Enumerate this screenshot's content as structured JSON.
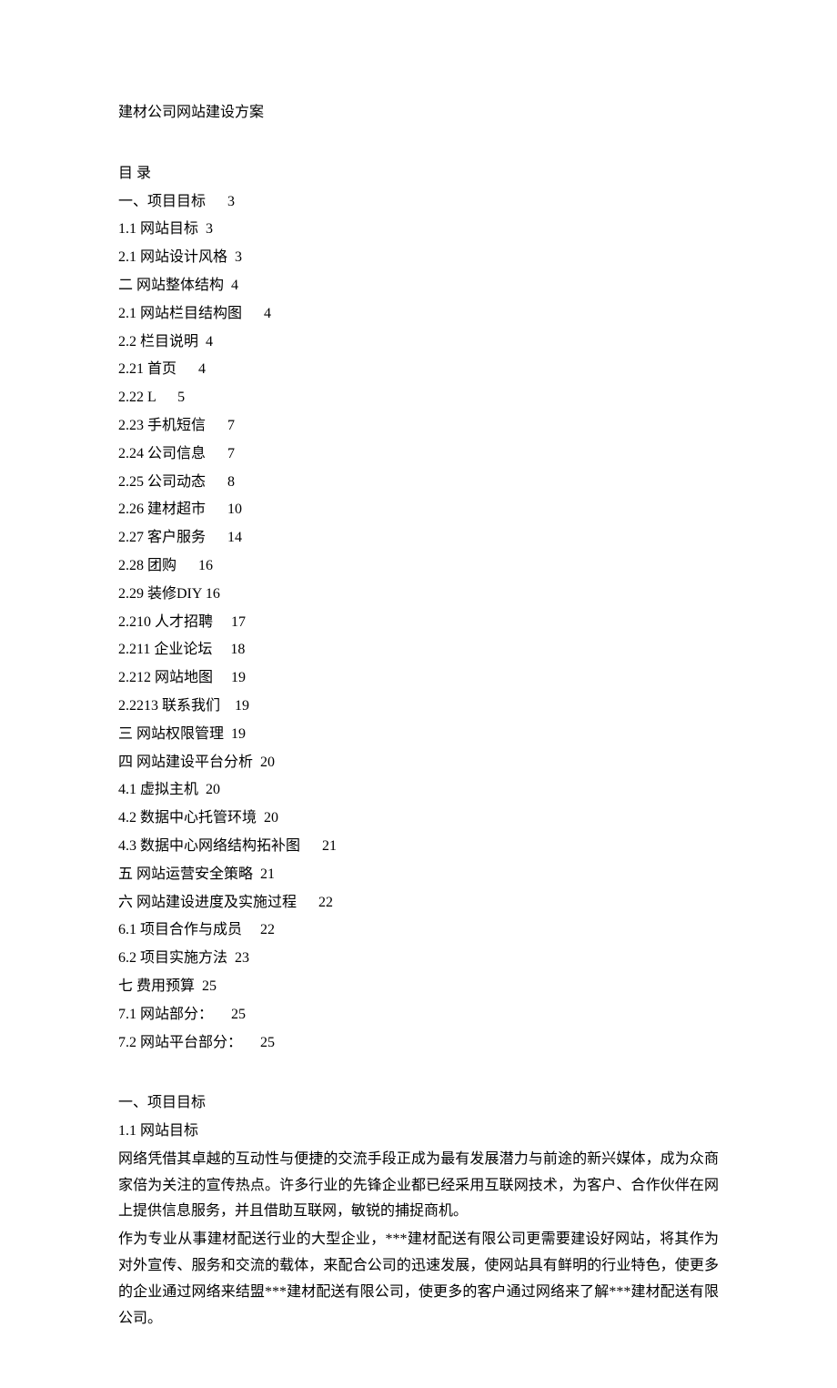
{
  "title": "建材公司网站建设方案",
  "toc_header": "目 录",
  "toc": [
    {
      "label": "一、项目目标",
      "page": "3"
    },
    {
      "label": "1.1 网站目标",
      "page": "3",
      "gap": "  "
    },
    {
      "label": "2.1 网站设计风格",
      "page": "3",
      "gap": "  "
    },
    {
      "label": "二 网站整体结构",
      "page": "4",
      "gap": "  "
    },
    {
      "label": "2.1 网站栏目结构图",
      "page": "4"
    },
    {
      "label": "2.2 栏目说明",
      "page": "4",
      "gap": "  "
    },
    {
      "label": "2.21 首页",
      "page": "4",
      "gap": "      "
    },
    {
      "label": "2.22 L",
      "page": "5"
    },
    {
      "label": "2.23 手机短信",
      "page": "7",
      "gap": "      "
    },
    {
      "label": "2.24 公司信息",
      "page": "7",
      "gap": "      "
    },
    {
      "label": "2.25 公司动态",
      "page": "8",
      "gap": "      "
    },
    {
      "label": "2.26 建材超市",
      "page": "10",
      "gap": "      "
    },
    {
      "label": "2.27 客户服务",
      "page": "14",
      "gap": "      "
    },
    {
      "label": "2.28 团购",
      "page": "16",
      "gap": "      "
    },
    {
      "label": "2.29 装修DIY",
      "page": "16",
      "gap": " "
    },
    {
      "label": "2.210 人才招聘",
      "page": "17",
      "gap": "     "
    },
    {
      "label": "2.211 企业论坛",
      "page": "18",
      "gap": "     "
    },
    {
      "label": "2.212 网站地图",
      "page": "19",
      "gap": "     "
    },
    {
      "label": "2.2213 联系我们",
      "page": "19",
      "gap": "    "
    },
    {
      "label": "三 网站权限管理",
      "page": "19",
      "gap": "  "
    },
    {
      "label": "四 网站建设平台分析",
      "page": "20",
      "gap": "  "
    },
    {
      "label": "4.1 虚拟主机",
      "page": "20",
      "gap": "  "
    },
    {
      "label": "4.2 数据中心托管环境",
      "page": "20",
      "gap": "  "
    },
    {
      "label": "4.3 数据中心网络结构拓补图",
      "page": "21",
      "gap": "      "
    },
    {
      "label": "五 网站运营安全策略",
      "page": "21",
      "gap": "  "
    },
    {
      "label": "六 网站建设进度及实施过程",
      "page": "22",
      "gap": "      "
    },
    {
      "label": "6.1 项目合作与成员",
      "page": "22",
      "gap": "     "
    },
    {
      "label": "6.2 项目实施方法",
      "page": "23",
      "gap": "  "
    },
    {
      "label": "七 费用预算",
      "page": "25",
      "gap": "  "
    },
    {
      "label": "7.1 网站部分：",
      "page": "25",
      "gap": "     "
    },
    {
      "label": "7.2 网站平台部分：",
      "page": "25",
      "gap": "     "
    }
  ],
  "section1_heading": "一、项目目标",
  "section1_sub": "1.1 网站目标",
  "para1": "网络凭借其卓越的互动性与便捷的交流手段正成为最有发展潜力与前途的新兴媒体，成为众商家倍为关注的宣传热点。许多行业的先锋企业都已经采用互联网技术，为客户、合作伙伴在网上提供信息服务，并且借助互联网，敏锐的捕捉商机。",
  "para2": "作为专业从事建材配送行业的大型企业，***建材配送有限公司更需要建设好网站，将其作为对外宣传、服务和交流的载体，来配合公司的迅速发展，使网站具有鲜明的行业特色，使更多的企业通过网络来结盟***建材配送有限公司，使更多的客户通过网络来了解***建材配送有限公司。"
}
